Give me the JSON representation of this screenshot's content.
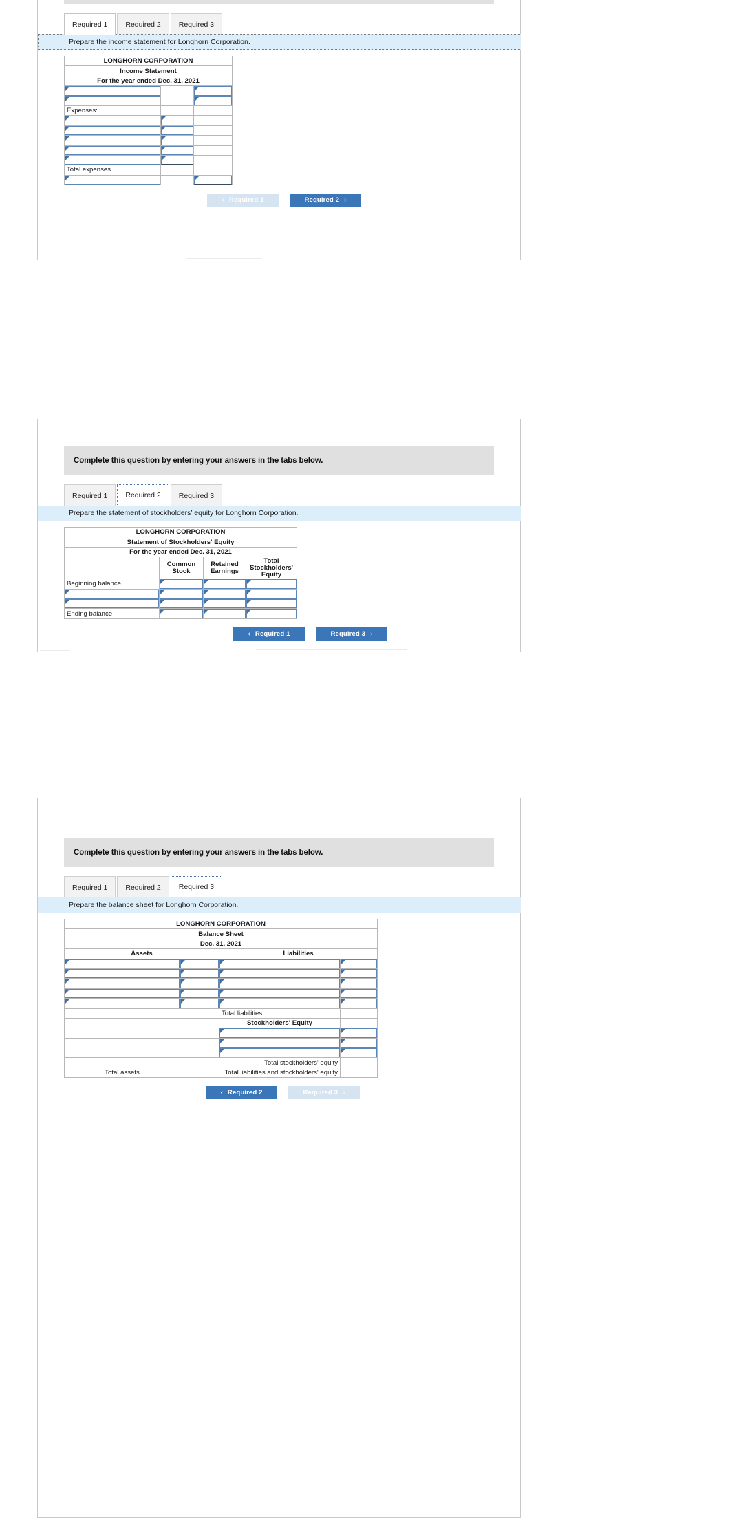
{
  "common": {
    "instruction": "Complete this question by entering your answers in the tabs below.",
    "tabs": [
      "Required 1",
      "Required 2",
      "Required 3"
    ],
    "company": "LONGHORN CORPORATION",
    "chev_left": "‹",
    "chev_right": "›",
    "accent_blue": "#3b76b8",
    "header_blue": "#77a6de",
    "prompt_blue": "#ddeefb",
    "instruction_grey": "#e0e0e0"
  },
  "panel1": {
    "active_tab": "Required 1",
    "prompt": "Prepare the income statement for Longhorn Corporation.",
    "statement": {
      "title": "LONGHORN CORPORATION",
      "subtitle": "Income Statement",
      "period": "For the year ended Dec. 31, 2021",
      "expenses_label": "Expenses:",
      "total_expenses_label": "Total expenses",
      "revenue_input_rows": 2,
      "expense_input_rows": 5,
      "net_input_rows": 1
    },
    "nav": {
      "prev": {
        "label": "Required 1",
        "disabled": true
      },
      "next": {
        "label": "Required 2",
        "disabled": false
      }
    }
  },
  "panel2": {
    "active_tab": "Required 2",
    "prompt": "Prepare the statement of stockholders’ equity for Longhorn Corporation.",
    "statement": {
      "title": "LONGHORN CORPORATION",
      "subtitle": "Statement of Stockholders' Equity",
      "period": "For the year ended Dec. 31, 2021",
      "columns": [
        "",
        "Common Stock",
        "Retained Earnings",
        "Total Stockholders' Equity"
      ],
      "rows": [
        {
          "label": "Beginning balance",
          "inputs": 3
        },
        {
          "label": "",
          "inputs": 3,
          "label_input": true
        },
        {
          "label": "",
          "inputs": 3,
          "label_input": true
        },
        {
          "label": "Ending balance",
          "inputs": 3
        }
      ]
    },
    "nav": {
      "prev": {
        "label": "Required 1",
        "disabled": false
      },
      "next": {
        "label": "Required 3",
        "disabled": false
      }
    }
  },
  "panel3": {
    "active_tab": "Required 3",
    "prompt": "Prepare the balance sheet for Longhorn Corporation.",
    "statement": {
      "title": "LONGHORN CORPORATION",
      "subtitle": "Balance Sheet",
      "period": "Dec. 31, 2021",
      "assets_header": "Assets",
      "liabilities_header": "Liabilities",
      "stockholders_equity_header": "Stockholders' Equity",
      "total_liabilities_label": "Total liabilities",
      "total_stockholders_equity_label": "Total stockholders' equity",
      "total_assets_label": "Total assets",
      "total_liab_and_equity_label": "Total liabilities and stockholders' equity",
      "asset_input_rows": 5,
      "liability_input_rows": 5,
      "equity_input_rows": 3
    },
    "nav": {
      "prev": {
        "label": "Required 2",
        "disabled": false
      },
      "next": {
        "label": "Required 3",
        "disabled": true
      }
    }
  }
}
